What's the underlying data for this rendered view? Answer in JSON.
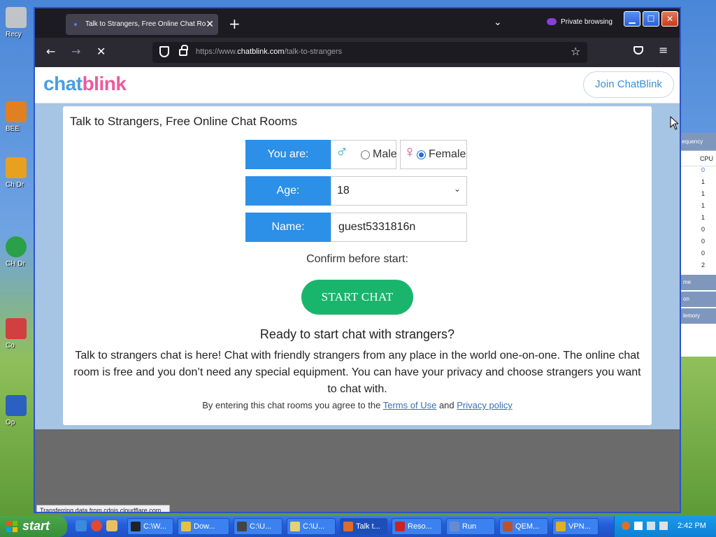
{
  "desktop": {
    "icons": [
      {
        "label": "Recy",
        "color": "#c0c4c8"
      },
      {
        "label": "BEE",
        "color": "#e08020"
      },
      {
        "label": "Ch Dr",
        "color": "#e8a020"
      },
      {
        "label": "CH Dr",
        "color": "#2aa048"
      },
      {
        "label": "Co",
        "color": "#d04040"
      },
      {
        "label": "Op",
        "color": "#2a60c0"
      }
    ],
    "bg_panel": {
      "header": "equency",
      "cpu_label": "CPU",
      "values": [
        "0",
        "1",
        "1",
        "1",
        "1",
        "0",
        "0",
        "0",
        "2"
      ],
      "sections": [
        "me",
        "on",
        "lemory"
      ]
    }
  },
  "browser": {
    "tab_title": "Talk to Strangers, Free Online Chat Ro",
    "private_label": "Private browsing",
    "url_prefix": "https://www.",
    "url_domain": "chatblink.com",
    "url_path": "/talk-to-strangers",
    "status_text": "Transferring data from cdnjs.cloudflare.com..."
  },
  "page": {
    "logo_chat": "chat",
    "logo_blink": "blink",
    "join_label": "Join ChatBlink",
    "title": "Talk to Strangers, Free Online Chat Rooms",
    "you_are_label": "You are:",
    "male_label": "Male",
    "female_label": "Female",
    "selected_gender": "Female",
    "age_label": "Age:",
    "age_value": "18",
    "name_label": "Name:",
    "name_value": "guest5331816n",
    "confirm_text": "Confirm before start:",
    "start_label": "START CHAT",
    "ready_heading": "Ready to start chat with strangers?",
    "description": "Talk to strangers chat is here! Chat with friendly strangers from any place in the world one-on-one. The online chat room is free and you don’t need any special equipment. You can have your privacy and choose strangers you want to chat with.",
    "terms_prefix": "By entering this chat rooms you agree to the",
    "terms_link": "Terms of Use",
    "terms_and": "and",
    "privacy_link": "Privacy policy",
    "colors": {
      "accent_blue": "#2c8fe8",
      "start_green": "#1ab56c",
      "logo_blue": "#4a9ee0",
      "logo_pink": "#ec5a9c"
    }
  },
  "taskbar": {
    "start_label": "start",
    "tasks": [
      {
        "label": "C:\\W...",
        "icon_color": "#222"
      },
      {
        "label": "Dow...",
        "icon_color": "#e8c040"
      },
      {
        "label": "C:\\U...",
        "icon_color": "#444"
      },
      {
        "label": "C:\\U...",
        "icon_color": "#e8d070"
      },
      {
        "label": "Talk t...",
        "icon_color": "#e06a2a"
      },
      {
        "label": "Reso...",
        "icon_color": "#d02020"
      },
      {
        "label": "Run",
        "icon_color": "#6a8ad0"
      },
      {
        "label": "QEM...",
        "icon_color": "#c0502a"
      },
      {
        "label": "VPN...",
        "icon_color": "#e0b020"
      }
    ],
    "clock": "2:42 PM"
  }
}
